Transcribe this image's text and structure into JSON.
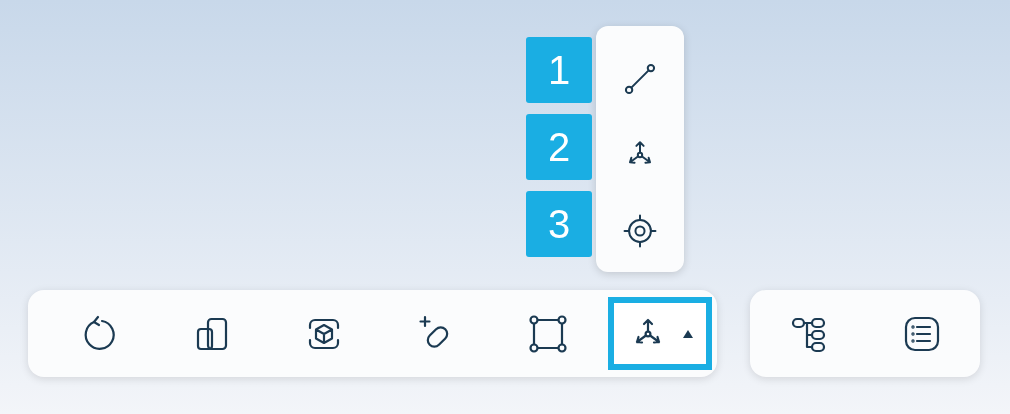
{
  "toolbar": {
    "tools": [
      {
        "kind": "button",
        "selected": false
      },
      {
        "kind": "button",
        "selected": false
      },
      {
        "kind": "button",
        "selected": false
      },
      {
        "kind": "button",
        "selected": false
      },
      {
        "kind": "button",
        "selected": false
      },
      {
        "kind": "dropdown",
        "selected": true
      }
    ]
  },
  "side_toolbar": {
    "tools": [
      {
        "selected": false
      },
      {
        "selected": false
      }
    ]
  },
  "dropdown_menu": {
    "items": [
      {
        "shortcut": "1"
      },
      {
        "shortcut": "2"
      },
      {
        "shortcut": "3"
      }
    ]
  }
}
